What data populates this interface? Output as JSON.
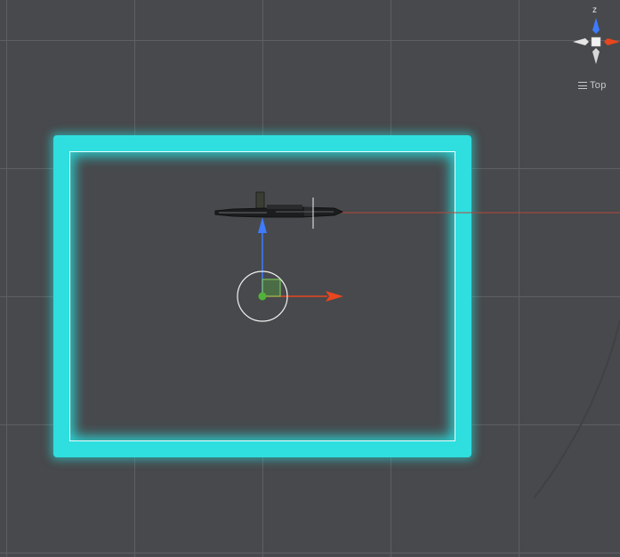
{
  "scene_view": {
    "view_label": "Top",
    "gizmo_axis_label": "z",
    "colors": {
      "background": "#47494c",
      "grid": "#5d5f62",
      "glow_frame": "#2fdede",
      "axis_x": "#e8461e",
      "axis_z": "#3e7bff",
      "pivot": "#52b33a",
      "selection_ray": "#b5483c"
    },
    "icons": {
      "gizmo": "orientation-gizmo-icon",
      "menu": "hamburger-menu-icon",
      "move_tool": "move-tool-handle-icon",
      "object": "rifle-model-icon"
    }
  }
}
